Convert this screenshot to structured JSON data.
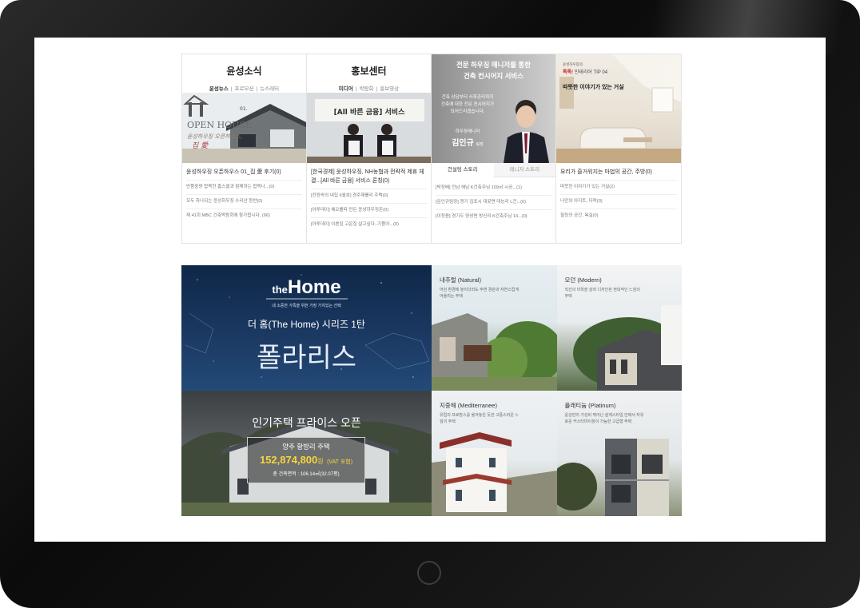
{
  "news": {
    "title": "윤성소식",
    "subtabs": [
      "윤성뉴스",
      "프로모션",
      "뉴스레터"
    ],
    "image_text": "OPEN HOUSE",
    "image_badge": "01.",
    "image_script": "윤성하우징 오픈하우스,",
    "image_script2": "집 愛",
    "headline": "윤성하우징 오픈하우스 01_집 愛 후기(0)",
    "items": [
      "반품중량 합목한 홈스클과 함께하는 합목나...(0)",
      "모두 하나되는 윤성하우징 수리산 등반(0)",
      "제 41회 MBC 건축박람회에 참가합니다. (66)"
    ]
  },
  "pr": {
    "title": "홍보센터",
    "subtabs": [
      "미디어",
      "박람회",
      "홍보영상"
    ],
    "banner": "[All 바른 금융] 서비스",
    "headline": "[한국경제] 윤성하우징, NH농협과 전략적 제휴 체결...[All 바른 금융] 서비스 론칭(0)",
    "items": [
      "[전원속의 내집 6월호] 경주재를리 주택(0)",
      "[아투데이] 혜오를따 만든 윤성하우징존(0)",
      "[아투데이] 이쁜집 고운집 살고싶다..기품아...(0)"
    ]
  },
  "consult": {
    "title_line1": "전문 하우징 매니저를 통한",
    "title_line2": "건축 컨시어지 서비스",
    "desc_line1": "건축 상담부터 사후관리까지",
    "desc_line2": "건축에 대한 전문 컨시어지가",
    "desc_line3": "되어드리겠습니다.",
    "role": "하우징매니저",
    "name": "김인규",
    "rank": "팀장",
    "tabs": [
      "건설팅 스토리",
      "매니저 스토리"
    ],
    "items": [
      "[박정배] 전남 해남 K건축주님 109㎡ 시공...(1)",
      "[김인규팀장] 경기 김포시 대곶면 대능리 L건...(0)",
      "[이정용] 경기도 양성면 방신리 K건축주님 14...(0)"
    ]
  },
  "interior": {
    "badge_small": "윤성하우징의",
    "badge_red": "톡톡!",
    "badge_tip": "인테리어 TIP 04",
    "title": "따뜻한 이야기가 있는 거실",
    "headline": "요리가 즐거워지는 마법의 공간, 주방(0)",
    "items": [
      "따뜻한 이야기가 있는 거실(2)",
      "나만의 아지트, 다락(0)",
      "힐링의 공간, 욕실(0)"
    ]
  },
  "hero": {
    "logo_small": "the",
    "logo_big": "Home",
    "tagline": "내 소중한 가족을 위한 가장 가치있는 선택",
    "series": "더 홈(The Home) 시리즈 1탄",
    "name": "폴라리스"
  },
  "promo": {
    "title": "인기주택 프라이스 오픈",
    "house": "양주 황방리 주택",
    "price": "152,874,800",
    "price_unit": "원",
    "vat": "(VAT 포함)",
    "area": "총 건축면적 : 106.14㎡(32.07평)"
  },
  "styles": [
    {
      "label": "내추럴 (Natural)",
      "desc": "어던 환경에 놓이더라도 주변 경관과 자연스럽게 어울리는 주택"
    },
    {
      "label": "모던 (Modern)",
      "desc": "직선의 미학을 살려 디자인된 현대적인 느낌의 주택"
    },
    {
      "label": "지중해 (Mediterranee)",
      "desc": "유럽의 프로방스를 옮겨놓은 듯한 고풍스러운 느낌의 주택"
    },
    {
      "label": "플래티늄 (Platinum)",
      "desc": "윤성만의 가성비 뛰어난 설계스타일 안에서 자유로운 커스터마이징이 가능한 고급형 주택"
    }
  ],
  "colors": {
    "hero_bg": "#1b365e",
    "price_yellow": "#f7d43b",
    "red_badge": "#d2262c"
  }
}
